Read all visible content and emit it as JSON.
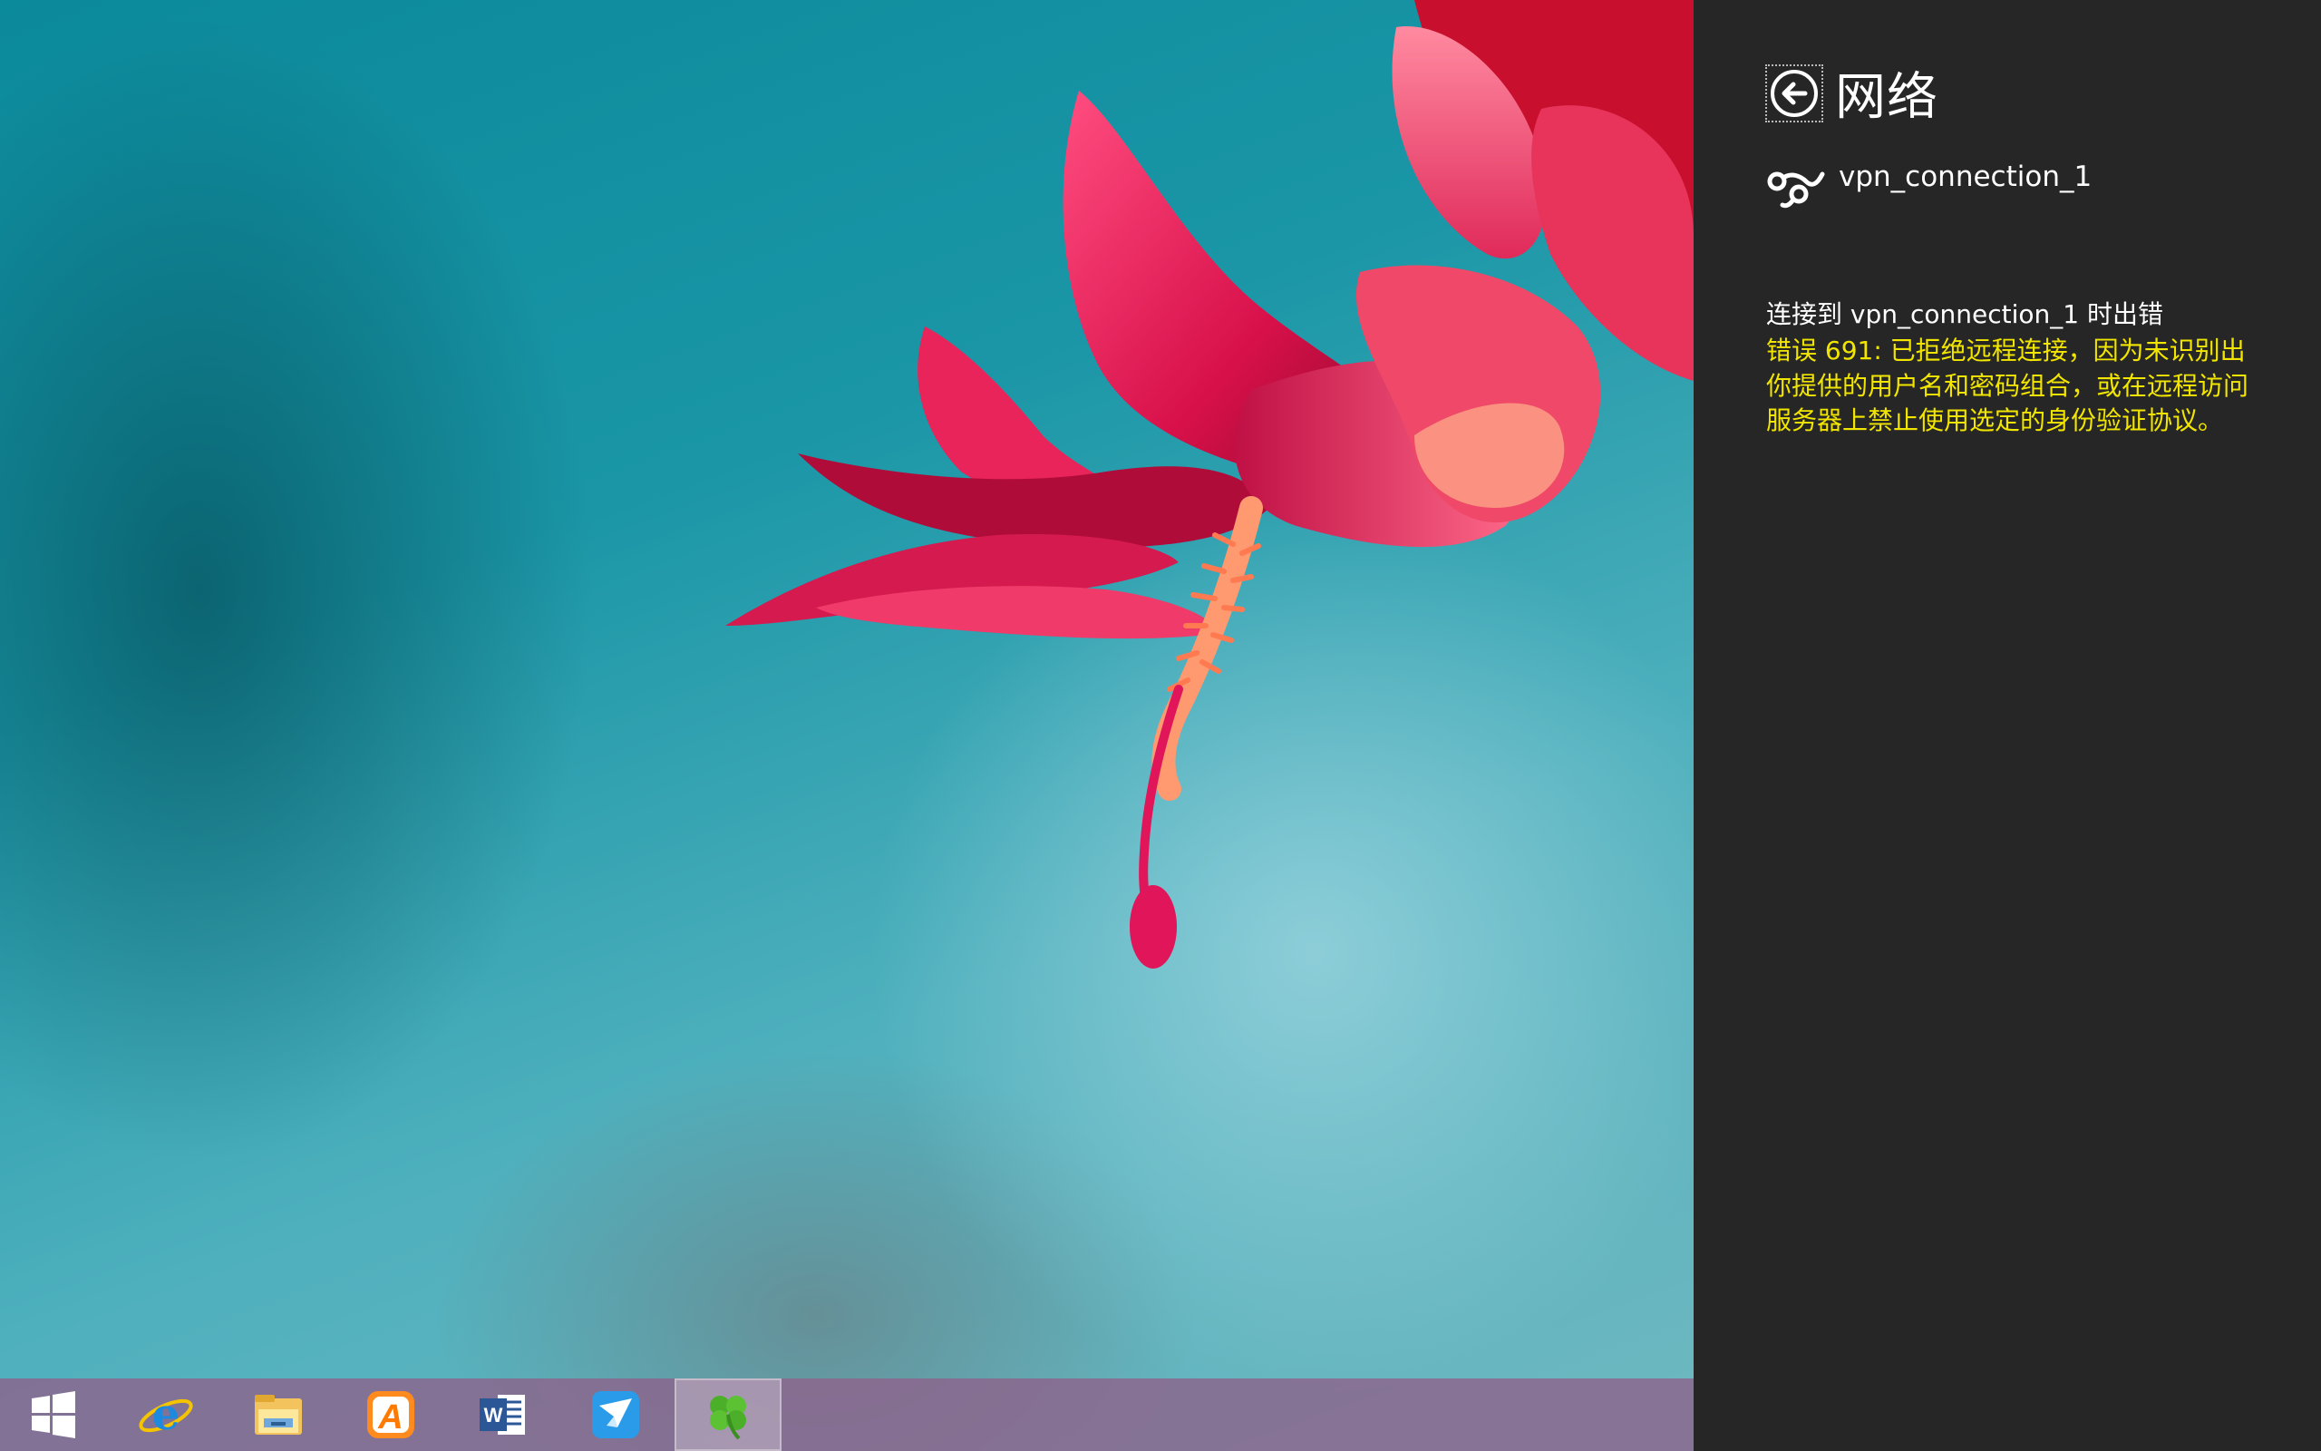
{
  "taskbar": {
    "items": [
      {
        "icon": "windows-start-icon",
        "label": "Start"
      },
      {
        "icon": "internet-explorer-icon",
        "label": "Internet Explorer"
      },
      {
        "icon": "file-explorer-icon",
        "label": "File Explorer"
      },
      {
        "icon": "orange-a-app-icon",
        "label": "App"
      },
      {
        "icon": "word-icon",
        "label": "Word"
      },
      {
        "icon": "bird-app-icon",
        "label": "App"
      },
      {
        "icon": "clover-app-icon",
        "label": "App",
        "active": true
      }
    ]
  },
  "panel": {
    "title": "网络",
    "connection": {
      "name": "vpn_connection_1",
      "icon": "vpn-connection-icon"
    },
    "error": {
      "heading": "连接到 vpn_connection_1 时出错",
      "message": "错误 691: 已拒绝远程连接，因为未识别出你提供的用户名和密码组合，或在远程访问服务器上禁止使用选定的身份验证协议。"
    }
  },
  "colors": {
    "panel_background": "#262626",
    "error_text": "#f2e600",
    "taskbar": "#8c648c"
  }
}
